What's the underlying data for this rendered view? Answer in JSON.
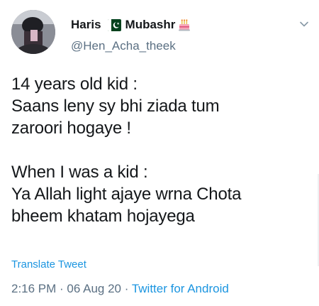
{
  "user": {
    "name_first": "Haris",
    "name_last": "Mubashr",
    "flag_icon": "pakistan-flag-icon",
    "badge_icon": "birthday-cake-icon",
    "handle": "@Hen_Acha_theek"
  },
  "menu_icon": "chevron-down-icon",
  "tweet": {
    "lines_block1": [
      "14 years old kid :",
      "Saans leny sy bhi ziada tum",
      "zaroori hogaye !"
    ],
    "lines_block2": [
      "When I was a kid :",
      "Ya Allah light ajaye wrna Chota",
      "bheem khatam hojayega"
    ]
  },
  "translate_label": "Translate Tweet",
  "meta": {
    "time": "2:16 PM",
    "separator": " · ",
    "date": "06 Aug 20",
    "source": "Twitter for Android"
  },
  "colors": {
    "text": "#14171a",
    "secondary": "#5b7083",
    "link": "#1b95e0"
  }
}
